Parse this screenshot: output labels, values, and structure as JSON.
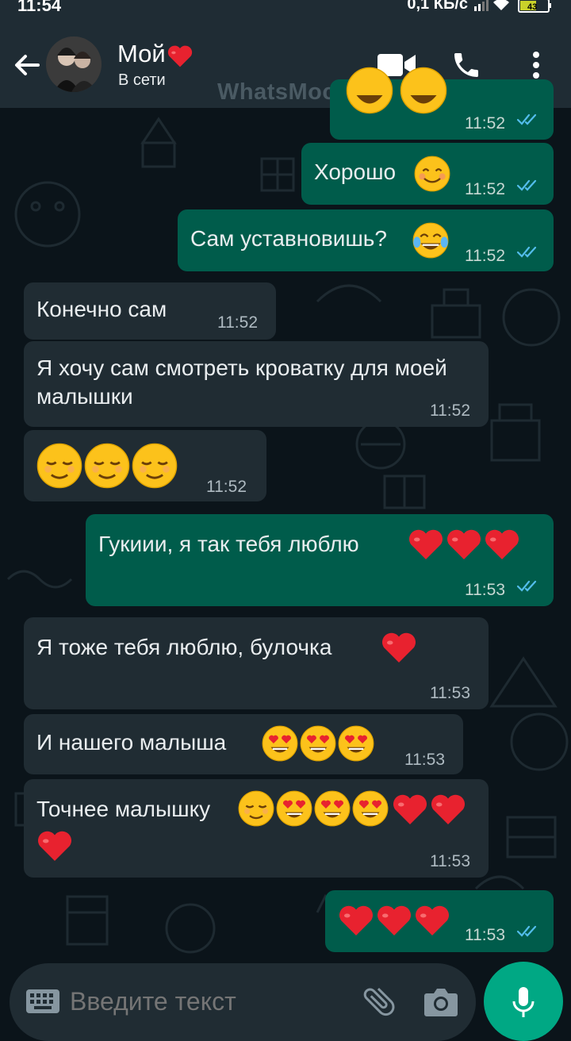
{
  "status_bar": {
    "time": "11:54",
    "net_speed": "0,1 КБ/с",
    "battery": "43"
  },
  "header": {
    "contact_name": "Мой",
    "contact_status": "В сети",
    "watermark": "WhatsMock"
  },
  "messages": [
    {
      "dir": "out",
      "text": "",
      "emojis": [
        "grin",
        "grin"
      ],
      "time": "11:52",
      "read": true
    },
    {
      "dir": "out",
      "text": "Хорошо",
      "emojis": [
        "smile"
      ],
      "time": "11:52",
      "read": true
    },
    {
      "dir": "out",
      "text": "Сам уставновишь?",
      "emojis": [
        "joy"
      ],
      "time": "11:52",
      "read": true
    },
    {
      "dir": "in",
      "text": "Конечно сам",
      "time": "11:52"
    },
    {
      "dir": "in",
      "text": "Я хочу сам смотреть кроватку для моей малышки",
      "time": "11:52"
    },
    {
      "dir": "in",
      "text": "",
      "emojis": [
        "relieved",
        "relieved",
        "relieved"
      ],
      "time": "11:52"
    },
    {
      "dir": "out",
      "text": "Гукиии, я так тебя люблю",
      "emojis": [
        "heart",
        "heart",
        "heart"
      ],
      "time": "11:53",
      "read": true
    },
    {
      "dir": "in",
      "text": "Я тоже тебя люблю, булочка",
      "emojis": [
        "heart"
      ],
      "time": "11:53"
    },
    {
      "dir": "in",
      "text": "И нашего малыша",
      "emojis": [
        "heart-eyes",
        "heart-eyes",
        "heart-eyes"
      ],
      "time": "11:53"
    },
    {
      "dir": "in",
      "text": "Точнее малышку",
      "emojis": [
        "relieved",
        "heart-eyes",
        "heart-eyes",
        "heart-eyes",
        "heart",
        "heart",
        "heart"
      ],
      "time": "11:53"
    },
    {
      "dir": "out",
      "text": "",
      "emojis": [
        "heart",
        "heart",
        "heart"
      ],
      "time": "11:53",
      "read": true
    }
  ],
  "composer": {
    "placeholder": "Введите текст"
  },
  "colors": {
    "header_bg": "#1f2c34",
    "chat_bg": "#0b141a",
    "incoming_bubble": "#202c33",
    "outgoing_bubble": "#005c4b",
    "accent": "#00a884",
    "read_ticks": "#53bdeb"
  },
  "icons": [
    "back-arrow-icon",
    "video-call-icon",
    "phone-icon",
    "more-vert-icon",
    "keyboard-icon",
    "attach-icon",
    "camera-icon",
    "mic-icon"
  ]
}
